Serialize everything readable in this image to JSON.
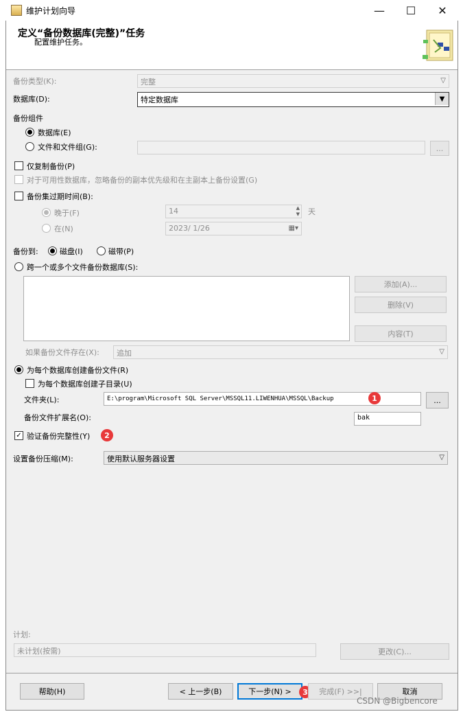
{
  "window": {
    "title": "维护计划向导",
    "minimize_glyph": "—",
    "maximize_glyph": "☐",
    "close_glyph": "✕"
  },
  "header": {
    "title": "定义“备份数据库(完整)”任务",
    "subtitle": "配置维护任务。",
    "icon": "wizard-icon"
  },
  "backup_type": {
    "label": "备份类型(K):",
    "value": "完整"
  },
  "database": {
    "label": "数据库(D):",
    "value": "特定数据库"
  },
  "backup_component": {
    "label": "备份组件",
    "option_database": "数据库(E)",
    "option_files": "文件和文件组(G):",
    "files_value": "",
    "browse_label": "..."
  },
  "copy_only": {
    "label": "仅复制备份(P)",
    "checked": false
  },
  "availability_db": {
    "label": "对于可用性数据库，忽略备份的副本优先级和在主副本上备份设置(G)",
    "checked": false
  },
  "backup_expiry": {
    "label": "备份集过期时间(B):",
    "checked": false,
    "after_label": "晚于(F)",
    "after_value": "14",
    "days_unit": "天",
    "on_label": "在(N)",
    "on_value": "2023/ 1/26"
  },
  "backup_to": {
    "label": "备份到:",
    "disk": "磁盘(I)",
    "tape": "磁带(P)"
  },
  "span_files": {
    "label": "跨一个或多个文件备份数据库(S):",
    "add_label": "添加(A)...",
    "remove_label": "删除(V)",
    "contents_label": "内容(T)",
    "if_exists_label": "如果备份文件存在(X):",
    "if_exists_value": "追加"
  },
  "per_db_file": {
    "label": "为每个数据库创建备份文件(R)",
    "subdir_label": "为每个数据库创建子目录(U)",
    "folder_label": "文件夹(L):",
    "folder_value": "E:\\program\\Microsoft SQL Server\\MSSQL11.LIWENHUA\\MSSQL\\Backup",
    "browse_label": "...",
    "ext_label": "备份文件扩展名(O):",
    "ext_value": "bak"
  },
  "verify": {
    "label": "验证备份完整性(Y)",
    "checked": true
  },
  "compression": {
    "label": "设置备份压缩(M):",
    "value": "使用默认服务器设置"
  },
  "schedule": {
    "label": "计划:",
    "value": "未计划(按需)",
    "change_label": "更改(C)..."
  },
  "footer": {
    "help_label": "帮助(H)",
    "back_label": "< 上一步(B)",
    "next_label": "下一步(N) >",
    "finish_label": "完成(F) >>|",
    "cancel_label": "取消"
  },
  "annotations": {
    "badge1": "1",
    "badge2": "2",
    "badge3": "3"
  },
  "watermark": "CSDN @Bigbencore",
  "colors": {
    "accent": "#0078d7",
    "badge": "#e8393a",
    "dialog_bg": "#f0f0f0"
  }
}
